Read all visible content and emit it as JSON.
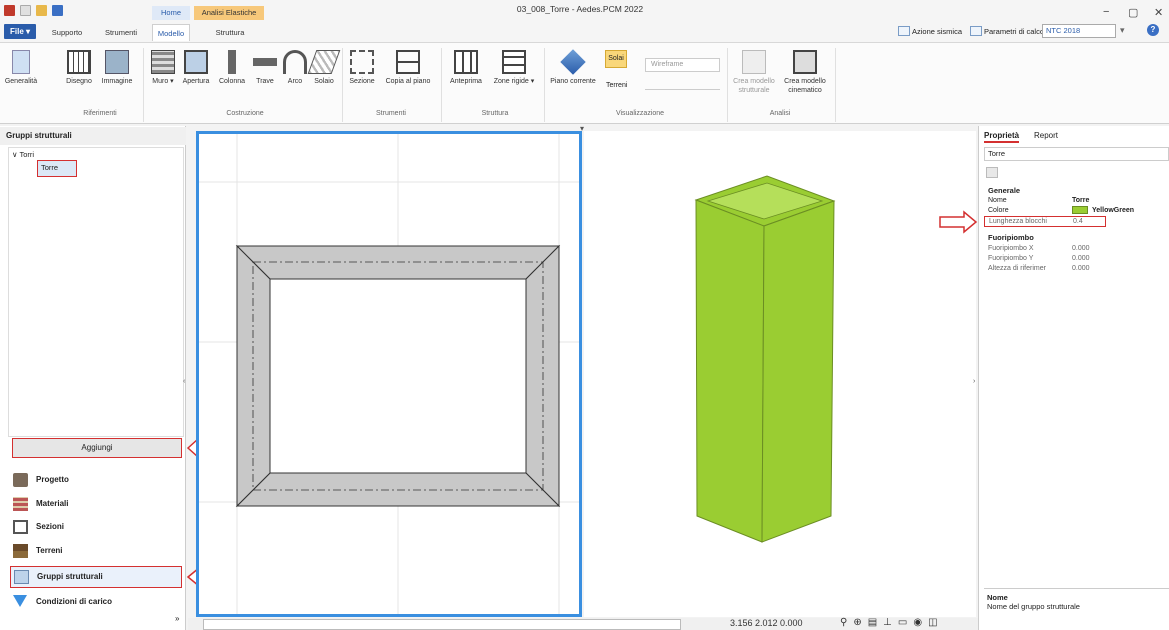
{
  "window": {
    "title": "03_008_Torre - Aedes.PCM 2022",
    "minimize": "−",
    "restore": "▢",
    "close": "✕"
  },
  "ribbon_tabs": {
    "file": "File ▾",
    "supporto": "Supporto",
    "strumenti": "Strumenti",
    "home": "Home",
    "modello": "Modello",
    "analisi_elastiche": "Analisi Elastiche",
    "struttura": "Struttura"
  },
  "right_tools": {
    "azione_sismica": "Azione sismica",
    "parametri": "Parametri di calcolo",
    "normativa": "NTC 2018",
    "help": "?"
  },
  "ribbon": {
    "generalita": "Generalità",
    "disegno": "Disegno",
    "immagine": "Immagine",
    "muro": "Muro ▾",
    "apertura": "Apertura",
    "colonna": "Colonna",
    "trave": "Trave",
    "arco": "Arco",
    "solaio": "Solaio",
    "sezione": "Sezione",
    "copia_piano": "Copia al piano",
    "anteprima": "Anteprima",
    "zone_rigide": "Zone rigide ▾",
    "piano_corrente": "Piano corrente",
    "solai": "Solai",
    "terreni": "Terreni",
    "wireframe": "Wireframe",
    "crea_strutturale": "Crea modello strutturale",
    "crea_cinematico": "Crea modello cinematico",
    "groups": {
      "riferimenti": "Riferimenti",
      "costruzione": "Costruzione",
      "strumenti": "Strumenti",
      "struttura": "Struttura",
      "visualizzazione": "Visualizzazione",
      "analisi": "Analisi"
    }
  },
  "left_panel": {
    "header": "Gruppi strutturali",
    "tree_root": "Torri",
    "tree_child": "Torre",
    "add_button": "Aggiungi",
    "nav": [
      "Progetto",
      "Materiali",
      "Sezioni",
      "Terreni",
      "Gruppi strutturali",
      "Condizioni di carico"
    ]
  },
  "right_panel": {
    "tab_proprieta": "Proprietà",
    "tab_report": "Report",
    "combo_value": "Torre",
    "section_generale": "Generale",
    "rows_generale": [
      {
        "key": "Nome",
        "value": "Torre"
      },
      {
        "key": "Colore",
        "value": "YellowGreen"
      },
      {
        "key": "Lunghezza blocchi",
        "value": "0.4"
      }
    ],
    "section_fuoripiombo": "Fuoripiombo",
    "rows_fuoripiombo": [
      {
        "key": "Fuoripiombo X",
        "value": "0.000"
      },
      {
        "key": "Fuoripiombo Y",
        "value": "0.000"
      },
      {
        "key": "Altezza di riferimer",
        "value": "0.000"
      }
    ],
    "desc_title": "Nome",
    "desc_text": "Nome del gruppo strutturale"
  },
  "status": {
    "coords": "3.156  2.012  0.000"
  },
  "colors": {
    "accent_blue": "#3a8fe0",
    "tower_green": "#9acd32",
    "annotation_red": "#d43030"
  }
}
